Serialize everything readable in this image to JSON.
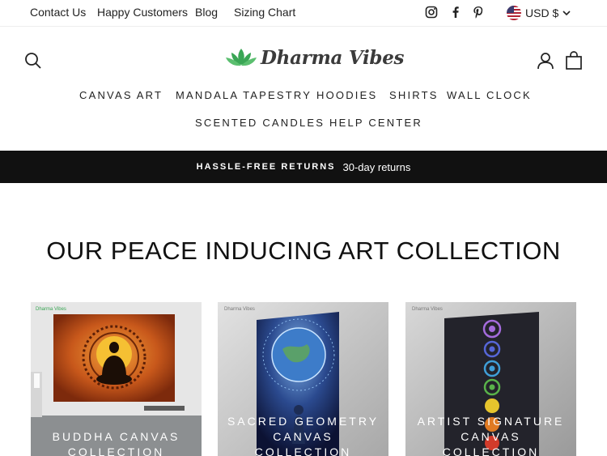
{
  "topbar": {
    "links": [
      "Contact Us",
      "Happy Customers",
      "Blog",
      "Sizing Chart"
    ],
    "social": [
      "instagram-icon",
      "facebook-icon",
      "pinterest-icon"
    ],
    "currency": "USD $"
  },
  "header": {
    "logo_text": "Dharma Vibes",
    "icons": [
      "search-icon",
      "account-icon",
      "cart-icon"
    ]
  },
  "nav": {
    "row1": [
      "CANVAS ART",
      "MANDALA TAPESTRY",
      "HOODIES",
      "SHIRTS",
      "WALL CLOCK"
    ],
    "row2": [
      "SCENTED CANDLES",
      "HELP CENTER"
    ]
  },
  "banner": {
    "strong": "HASSLE-FREE RETURNS",
    "text": "30-day returns"
  },
  "section": {
    "title": "OUR PEACE INDUCING ART COLLECTION"
  },
  "collections": [
    {
      "label_lines": [
        "BUDDHA CANVAS",
        "COLLECTION"
      ]
    },
    {
      "label_lines": [
        "SACRED GEOMETRY",
        "CANVAS",
        "COLLECTION"
      ]
    },
    {
      "label_lines": [
        "ARTIST SIGNATURE",
        "CANVAS",
        "COLLECTION"
      ]
    }
  ],
  "colors": {
    "banner_bg": "#111111",
    "logo_green": "#3aa655",
    "text": "#222222"
  }
}
